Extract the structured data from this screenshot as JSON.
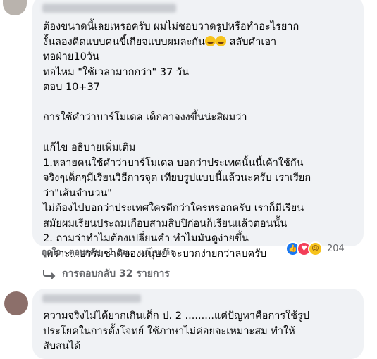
{
  "comment1": {
    "lines": [
      "ต้องขนาดนี้เลยเหรอครับ ผมไม่ชอบวาดรูปหรือทำอะไรยาก",
      "งั้นลองคิดแบบคนขี้เกียจแบบผมละกัน",
      "ทอฝ่าย10วัน",
      "ทอไหม \"ใช้เวลามากกว่า\" 37 วัน",
      "ตอบ 10+37",
      "",
      "การใช้คำว่าบาร์โมเดล เด็กอาจงงขึ้นน่ะสิผมว่า",
      "",
      "แก้ไข อธิบายเพิ่มเติม",
      "1.หลายคนใช้คำว่าบาร์โมเดล บอกว่าประเทศนั้นนี้เค้าใช้กัน",
      "จริงๆเด็กๆมีเรียนวิธีการจุด เทียบรูปแบบนี้แล้วนะครับ เราเรียก",
      "ว่า\"เส้นจำนวน\"",
      "ไม่ต้องไปบอกว่าประเทศใครดีกว่าใครหรอกครับ เราก็มีเรียน",
      "สมัยผมเรียนประถมเกือบสามสิบปีก่อนก็เรียนแล้วตอนนั้น",
      "2. ถามว่าทำไมต้องเปลี่ยนคำ ทำไมมันดูง่ายขึ้น",
      "เพราะ...ธรรมชาติของมนุษย์ จะบวกง่ายกว่าลบครับ"
    ],
    "line2_suffix": " สลับคำเอา",
    "like_label": "ถูกใจ",
    "reply_label": "ตอบกลับ",
    "time": "1 ชม.",
    "edited_label": "แก้ไขแล้ว",
    "reaction_count": "204",
    "replies_label": "การตอบกลับ 32 รายการ"
  },
  "comment2": {
    "lines": [
      "ความจริงไม่ได้ยากเกินเด็ก ป. 2 .........แต่ปัญหาคือการใช้รูป",
      "ประโยคในการตั้งโจทย์ ใช้ภาษาไม่ค่อยจะเหมาะสม ทำให้",
      "สับสนได้"
    ]
  },
  "colors": {
    "bubble": "#f0f2f5",
    "meta": "#65676b",
    "like": "#1877f2",
    "love": "#f33e58",
    "haha": "#f7c31c"
  },
  "icons": [
    "like-reaction-icon",
    "love-reaction-icon",
    "haha-reaction-icon",
    "laughing-emoji-icon",
    "reply-arrow-icon"
  ]
}
